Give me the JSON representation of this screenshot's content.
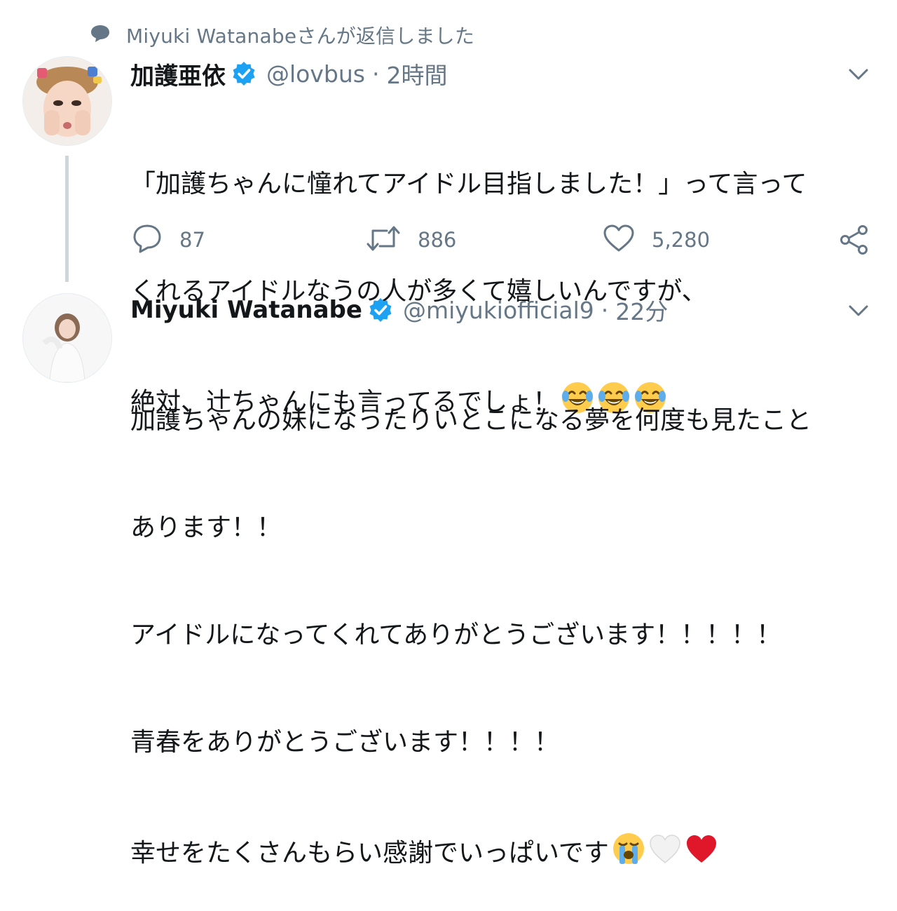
{
  "context": {
    "text": "Miyuki Watanabeさんが返信しました"
  },
  "tweet1": {
    "display_name": "加護亜依",
    "handle": "@lovbus",
    "separator": "·",
    "time": "2時間",
    "lines": [
      "「加護ちゃんに憧れてアイドル目指しました！」って言って",
      "くれるアイドルなうの人が多くて嬉しいんですが、",
      "絶対、辻ちゃんにも言ってるでしょ！"
    ],
    "emojis": [
      "face-with-tears-of-joy",
      "face-with-tears-of-joy",
      "face-with-tears-of-joy"
    ],
    "replies": "87",
    "retweets": "886",
    "likes": "5,280"
  },
  "tweet2": {
    "display_name": "Miyuki Watanabe",
    "handle": "@miyukiofficial9",
    "separator": "·",
    "time": "22分",
    "lines": [
      "加護ちゃんの妹になったりいとこになる夢を何度も見たこと",
      "あります！！",
      "アイドルになってくれてありがとうございます！！！！！",
      "青春をありがとうございます！！！！",
      "幸せをたくさんもらい感謝でいっぱいです"
    ],
    "emojis": [
      "loudly-crying-face",
      "white-heart",
      "red-heart"
    ]
  },
  "colors": {
    "verified": "#1da1f2",
    "secondary_text": "#657786",
    "thread_line": "#ccd6dd",
    "heart_red": "#e0162b"
  }
}
